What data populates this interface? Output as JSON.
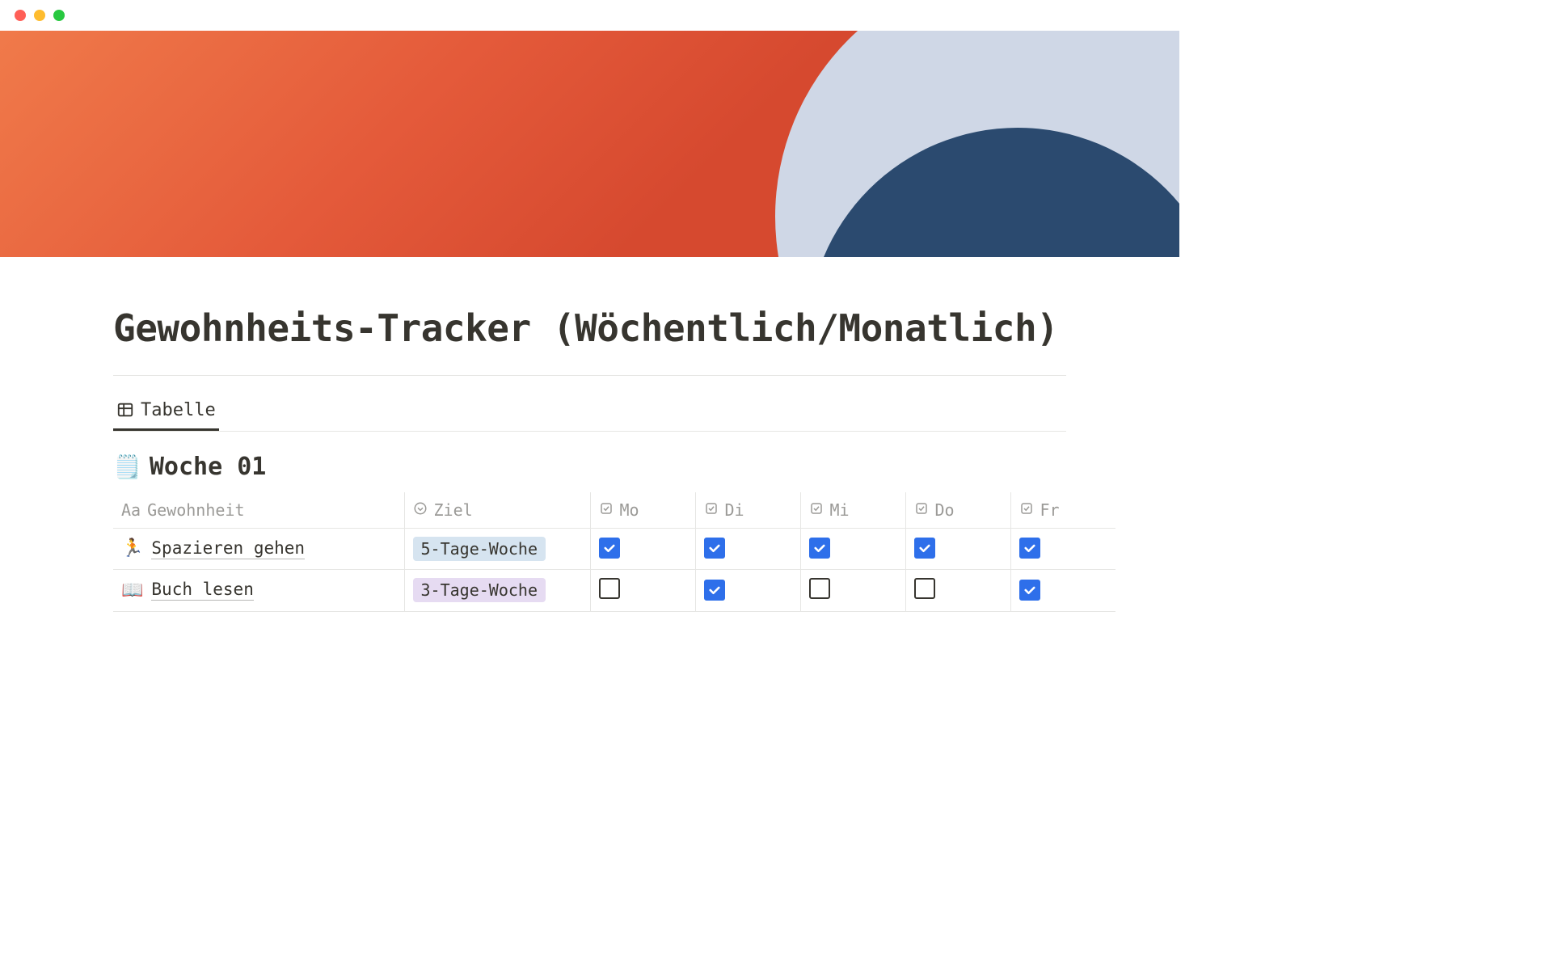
{
  "page": {
    "title": "Gewohnheits-Tracker (Wöchentlich/Monatlich)"
  },
  "tabs": {
    "active_label": "Tabelle"
  },
  "section": {
    "emoji": "🗒️",
    "title": "Woche 01"
  },
  "columns": {
    "name": "Gewohnheit",
    "goal": "Ziel",
    "days": [
      "Mo",
      "Di",
      "Mi",
      "Do",
      "Fr"
    ]
  },
  "rows": [
    {
      "emoji": "🏃",
      "name": "Spazieren gehen",
      "goal": {
        "label": "5-Tage-Woche",
        "style": "blue"
      },
      "checks": [
        true,
        true,
        true,
        true,
        true
      ]
    },
    {
      "emoji": "📖",
      "name": "Buch lesen",
      "goal": {
        "label": "3-Tage-Woche",
        "style": "purple"
      },
      "checks": [
        false,
        true,
        false,
        false,
        true
      ]
    }
  ]
}
